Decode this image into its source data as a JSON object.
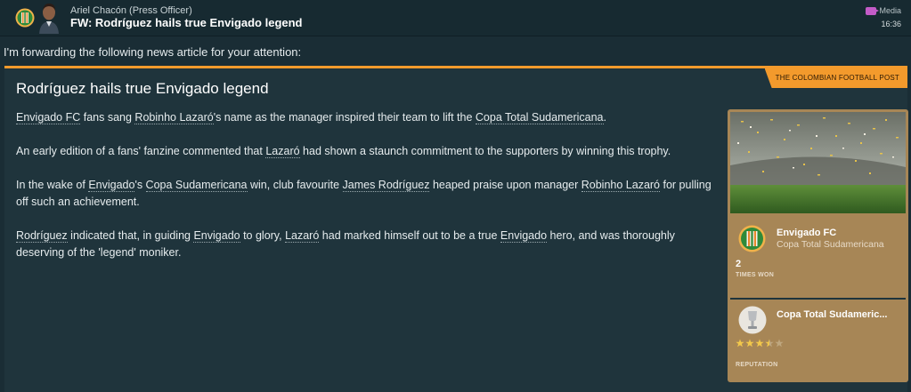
{
  "header": {
    "sender": "Ariel Chacón  (Press Officer)",
    "subject": "FW: Rodríguez hails true Envigado legend",
    "tag": "Media",
    "time": "16:36"
  },
  "forward_text": "I'm forwarding the following news article for your attention:",
  "article": {
    "publisher": "THE COLOMBIAN FOOTBALL POST",
    "title": "Rodríguez hails true Envigado legend",
    "paragraphs": [
      [
        {
          "t": "Envigado FC",
          "link": true
        },
        {
          "t": " fans sang "
        },
        {
          "t": "Robinho Lazaró",
          "link": true
        },
        {
          "t": "'s name as the manager inspired their team to lift the "
        },
        {
          "t": "Copa Total Sudamericana",
          "link": true
        },
        {
          "t": "."
        }
      ],
      [
        {
          "t": "An early edition of a fans' fanzine commented that "
        },
        {
          "t": "Lazaró",
          "link": true
        },
        {
          "t": " had shown a staunch commitment to the supporters by winning this trophy."
        }
      ],
      [
        {
          "t": "In the wake of "
        },
        {
          "t": "Envigado",
          "link": true
        },
        {
          "t": "'s "
        },
        {
          "t": "Copa Sudamericana",
          "link": true
        },
        {
          "t": " win, club favourite "
        },
        {
          "t": "James Rodríguez",
          "link": true
        },
        {
          "t": " heaped praise upon manager "
        },
        {
          "t": "Robinho Lazaró",
          "link": true
        },
        {
          "t": " for pulling off such an achievement."
        }
      ],
      [
        {
          "t": "Rodríguez",
          "link": true
        },
        {
          "t": " indicated that, in guiding "
        },
        {
          "t": "Envigado",
          "link": true
        },
        {
          "t": " to glory, "
        },
        {
          "t": "Lazaró",
          "link": true
        },
        {
          "t": " had marked himself out to be a true "
        },
        {
          "t": "Envigado",
          "link": true
        },
        {
          "t": " hero, and was thoroughly deserving of the 'legend' moniker."
        }
      ]
    ]
  },
  "side_panel": {
    "club_name": "Envigado FC",
    "club_competition": "Copa Total Sudamericana",
    "times_won_value": "2",
    "times_won_label": "TIMES WON",
    "competition_name": "Copa Total Sudameric...",
    "reputation_stars": 3.5,
    "reputation_max": 5,
    "reputation_label": "REPUTATION"
  },
  "colors": {
    "accent_orange": "#f39a2c",
    "panel_gold": "#a78656",
    "background": "#1a2d35",
    "media_purple": "#c35bc7",
    "club_green": "#3f8f3f",
    "club_orange": "#e7882c"
  },
  "icons": {
    "club_badge": "envigado-badge-icon",
    "media": "media-tag-icon",
    "trophy": "trophy-icon",
    "star": "star-icon"
  }
}
